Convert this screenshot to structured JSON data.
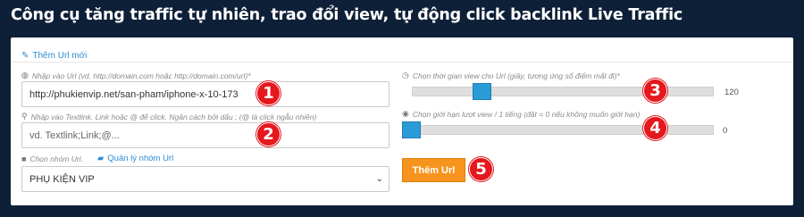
{
  "page": {
    "title": "Công cụ tăng traffic tự nhiên, trao đổi view, tự động click backlink Live Traffic"
  },
  "panel": {
    "add_url_label": "Thêm Url mới",
    "url_field": {
      "hint": "Nhập vào Url (vd. http://domain.com hoặc http://domain.com/url)*",
      "value": "http://phukienvip.net/san-pham/iphone-x-10-173",
      "icon": "globe-icon"
    },
    "textlink_field": {
      "hint": "Nhập vào Textlink. Link hoặc @ để click. Ngăn cách bởi dấu ; (@ là click ngẫu nhiên)",
      "placeholder": "vd. Textlink;Link;@...",
      "icon": "link-icon"
    },
    "group": {
      "hint": "Chọn nhóm Url.",
      "manage_label": "Quản lý nhóm Url",
      "selected": "PHỤ KIỆN VIP",
      "icon": "folder-icon"
    },
    "view_time": {
      "hint": "Chọn thời gian view cho Url (giây, tương ứng số điểm mất đi)*",
      "value": "120",
      "fraction": 0.24,
      "icon": "clock-icon"
    },
    "view_limit": {
      "hint": "Chọn giới hạn lượt view / 1 tiếng (đặt = 0 nếu không muốn giới hạn)",
      "value": "0",
      "fraction": 0.0,
      "icon": "eye-icon"
    },
    "submit_label": "Thêm Url"
  },
  "annotations": [
    "1",
    "2",
    "3",
    "4",
    "5"
  ],
  "colors": {
    "background": "#0e2038",
    "accent": "#2d8bd4",
    "slider": "#2a9bd6",
    "button": "#f7941d",
    "badge": "#e4181d"
  }
}
